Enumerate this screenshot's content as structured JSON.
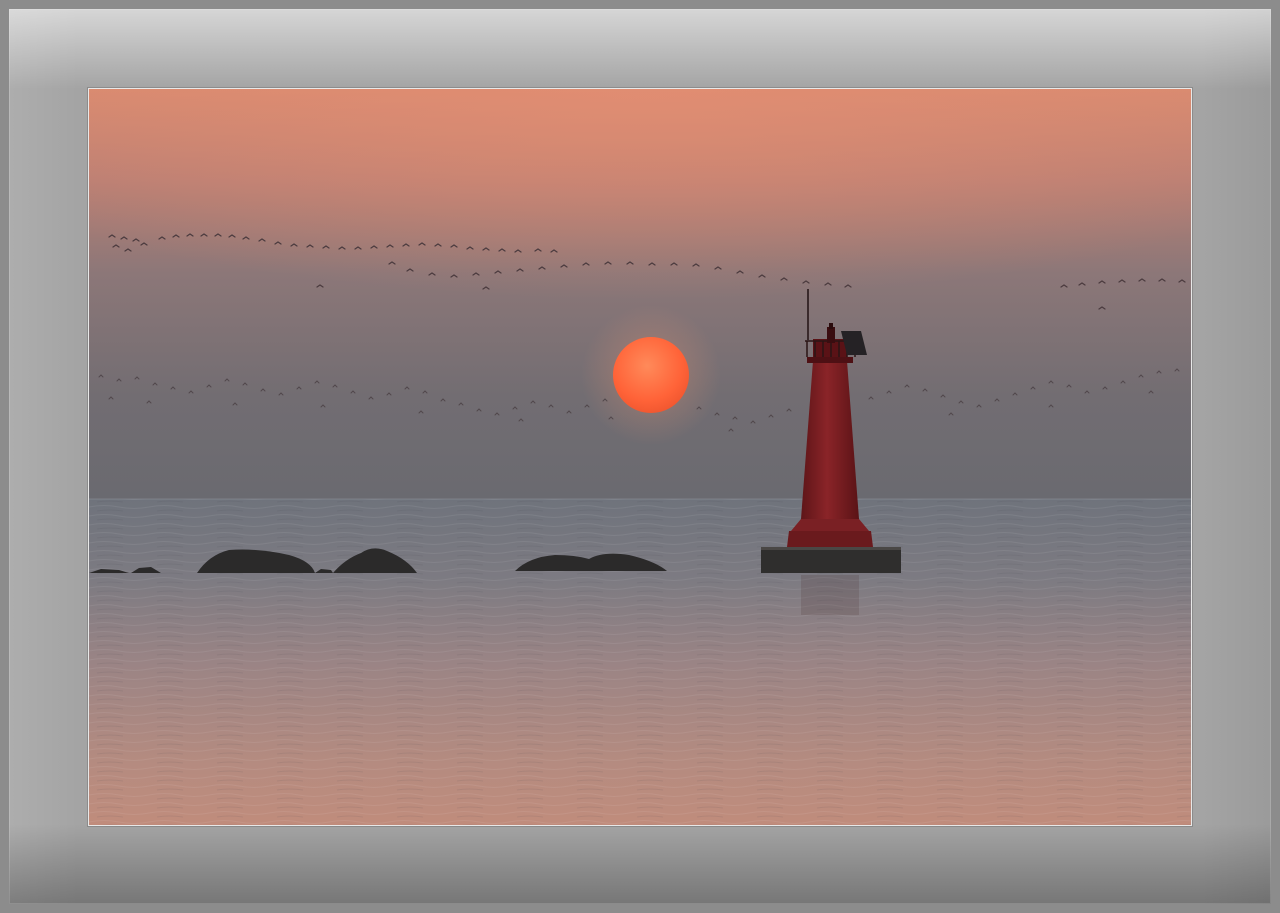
{
  "scene": {
    "sky_top_color": "#d88a72",
    "sky_mid_color": "#8b7474",
    "sky_horizon_color": "#6d6a6f",
    "sea_color_far": "#73777f",
    "sea_color_near": "#b88a7f",
    "sun_color": "#ff6a40",
    "lighthouse_color": "#7a1f22",
    "rock_color": "#2c2b2b",
    "frame_color": "#a4a4a4"
  }
}
